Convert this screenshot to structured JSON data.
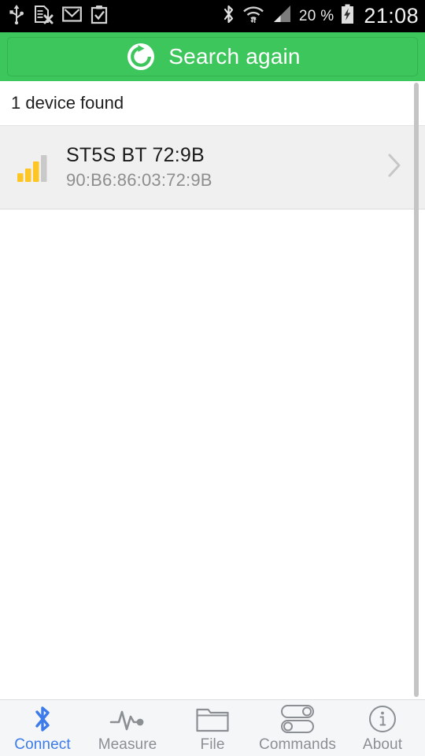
{
  "statusbar": {
    "left_icons": [
      {
        "name": "usb-icon"
      },
      {
        "name": "sd-card-removed-icon"
      },
      {
        "name": "gmail-icon"
      },
      {
        "name": "clipboard-check-icon"
      }
    ],
    "right_icons": [
      {
        "name": "bluetooth-icon"
      },
      {
        "name": "wifi-icon"
      },
      {
        "name": "cellular-signal-icon"
      }
    ],
    "battery_percent": "20 %",
    "battery_icon": "battery-charging-icon",
    "clock": "21:08"
  },
  "search": {
    "label": "Search again",
    "icon": "refresh-icon",
    "bar_color": "#3cc65b"
  },
  "list": {
    "header": "1 device found",
    "devices": [
      {
        "name": "ST5S BT 72:9B",
        "mac": "90:B6:86:03:72:9B",
        "signal_icon": "signal-bars-icon",
        "signal_bars_filled": 3,
        "signal_bars_total": 4,
        "chevron_icon": "chevron-right-icon"
      }
    ]
  },
  "tabbar": {
    "active_color": "#3b7bea",
    "inactive_color": "#8b8f94",
    "tabs": [
      {
        "label": "Connect",
        "icon": "bluetooth-icon",
        "active": true
      },
      {
        "label": "Measure",
        "icon": "waveform-icon",
        "active": false
      },
      {
        "label": "File",
        "icon": "folder-icon",
        "active": false
      },
      {
        "label": "Commands",
        "icon": "toggles-icon",
        "active": false
      },
      {
        "label": "About",
        "icon": "info-circle-icon",
        "active": false
      }
    ]
  }
}
